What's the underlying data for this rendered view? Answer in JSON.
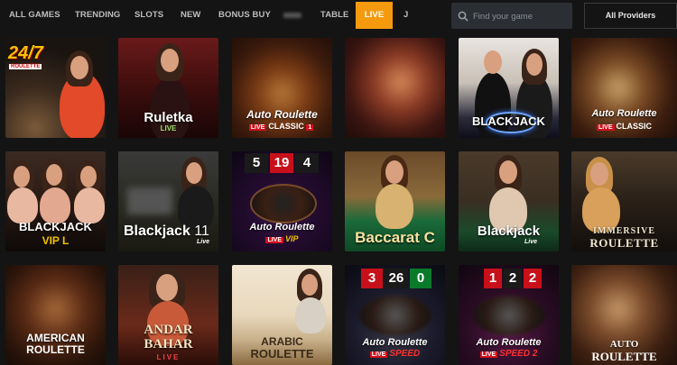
{
  "nav": {
    "tabs": [
      {
        "label": "ALL GAMES"
      },
      {
        "label": "TRENDING"
      },
      {
        "label": "SLOTS"
      },
      {
        "label": "NEW"
      },
      {
        "label": "BONUS BUY"
      },
      {
        "label": "TABLE"
      },
      {
        "label": "LIVE"
      },
      {
        "label": "J"
      }
    ],
    "search_placeholder": "Find your game",
    "providers_label": "All Providers"
  },
  "colors": {
    "accent": "#f59a0e",
    "background": "#141414",
    "live_red": "#d0101c"
  },
  "games": {
    "r1": [
      {
        "logo": "24/7",
        "logo_sub": "ROULETTE"
      },
      {
        "title": "Ruletka",
        "sub": "LIVE"
      },
      {
        "title": "Auto Roulette",
        "sub_live": "LIVE",
        "sub": "CLASSIC",
        "sub_num": "1"
      },
      {},
      {
        "title": "BLACKJACK"
      },
      {
        "title": "Auto Roulette",
        "sub_live": "LIVE",
        "sub": "CLASSIC"
      }
    ],
    "r2": [
      {
        "title": "BLACKJACK",
        "sub": "VIP L"
      },
      {
        "title": "Blackjack",
        "num": "11",
        "sub": "Live"
      },
      {
        "numbers": [
          "5",
          "19",
          "4"
        ],
        "title": "Auto Roulette",
        "sub_live": "LIVE",
        "sub": "VIP"
      },
      {
        "title": "Baccarat C"
      },
      {
        "title": "Blackjack",
        "sub": "Live"
      },
      {
        "title": "IMMERSIVE",
        "sub": "ROULETTE"
      }
    ],
    "r3": [
      {
        "title": "AMERICAN",
        "sub": "ROULETTE"
      },
      {
        "title": "ANDAR",
        "title2": "BAHAR",
        "sub": "LIVE"
      },
      {
        "title": "ARABIC",
        "sub": "ROULETTE"
      },
      {
        "numbers": [
          "3",
          "26",
          "0"
        ],
        "title": "Auto Roulette",
        "sub_live": "LIVE",
        "sub": "SPEED"
      },
      {
        "numbers": [
          "1",
          "2",
          "2"
        ],
        "title": "Auto Roulette",
        "sub_live": "LIVE",
        "sub": "SPEED 2"
      },
      {
        "title": "AUTO",
        "sub": "ROULETTE"
      }
    ]
  }
}
